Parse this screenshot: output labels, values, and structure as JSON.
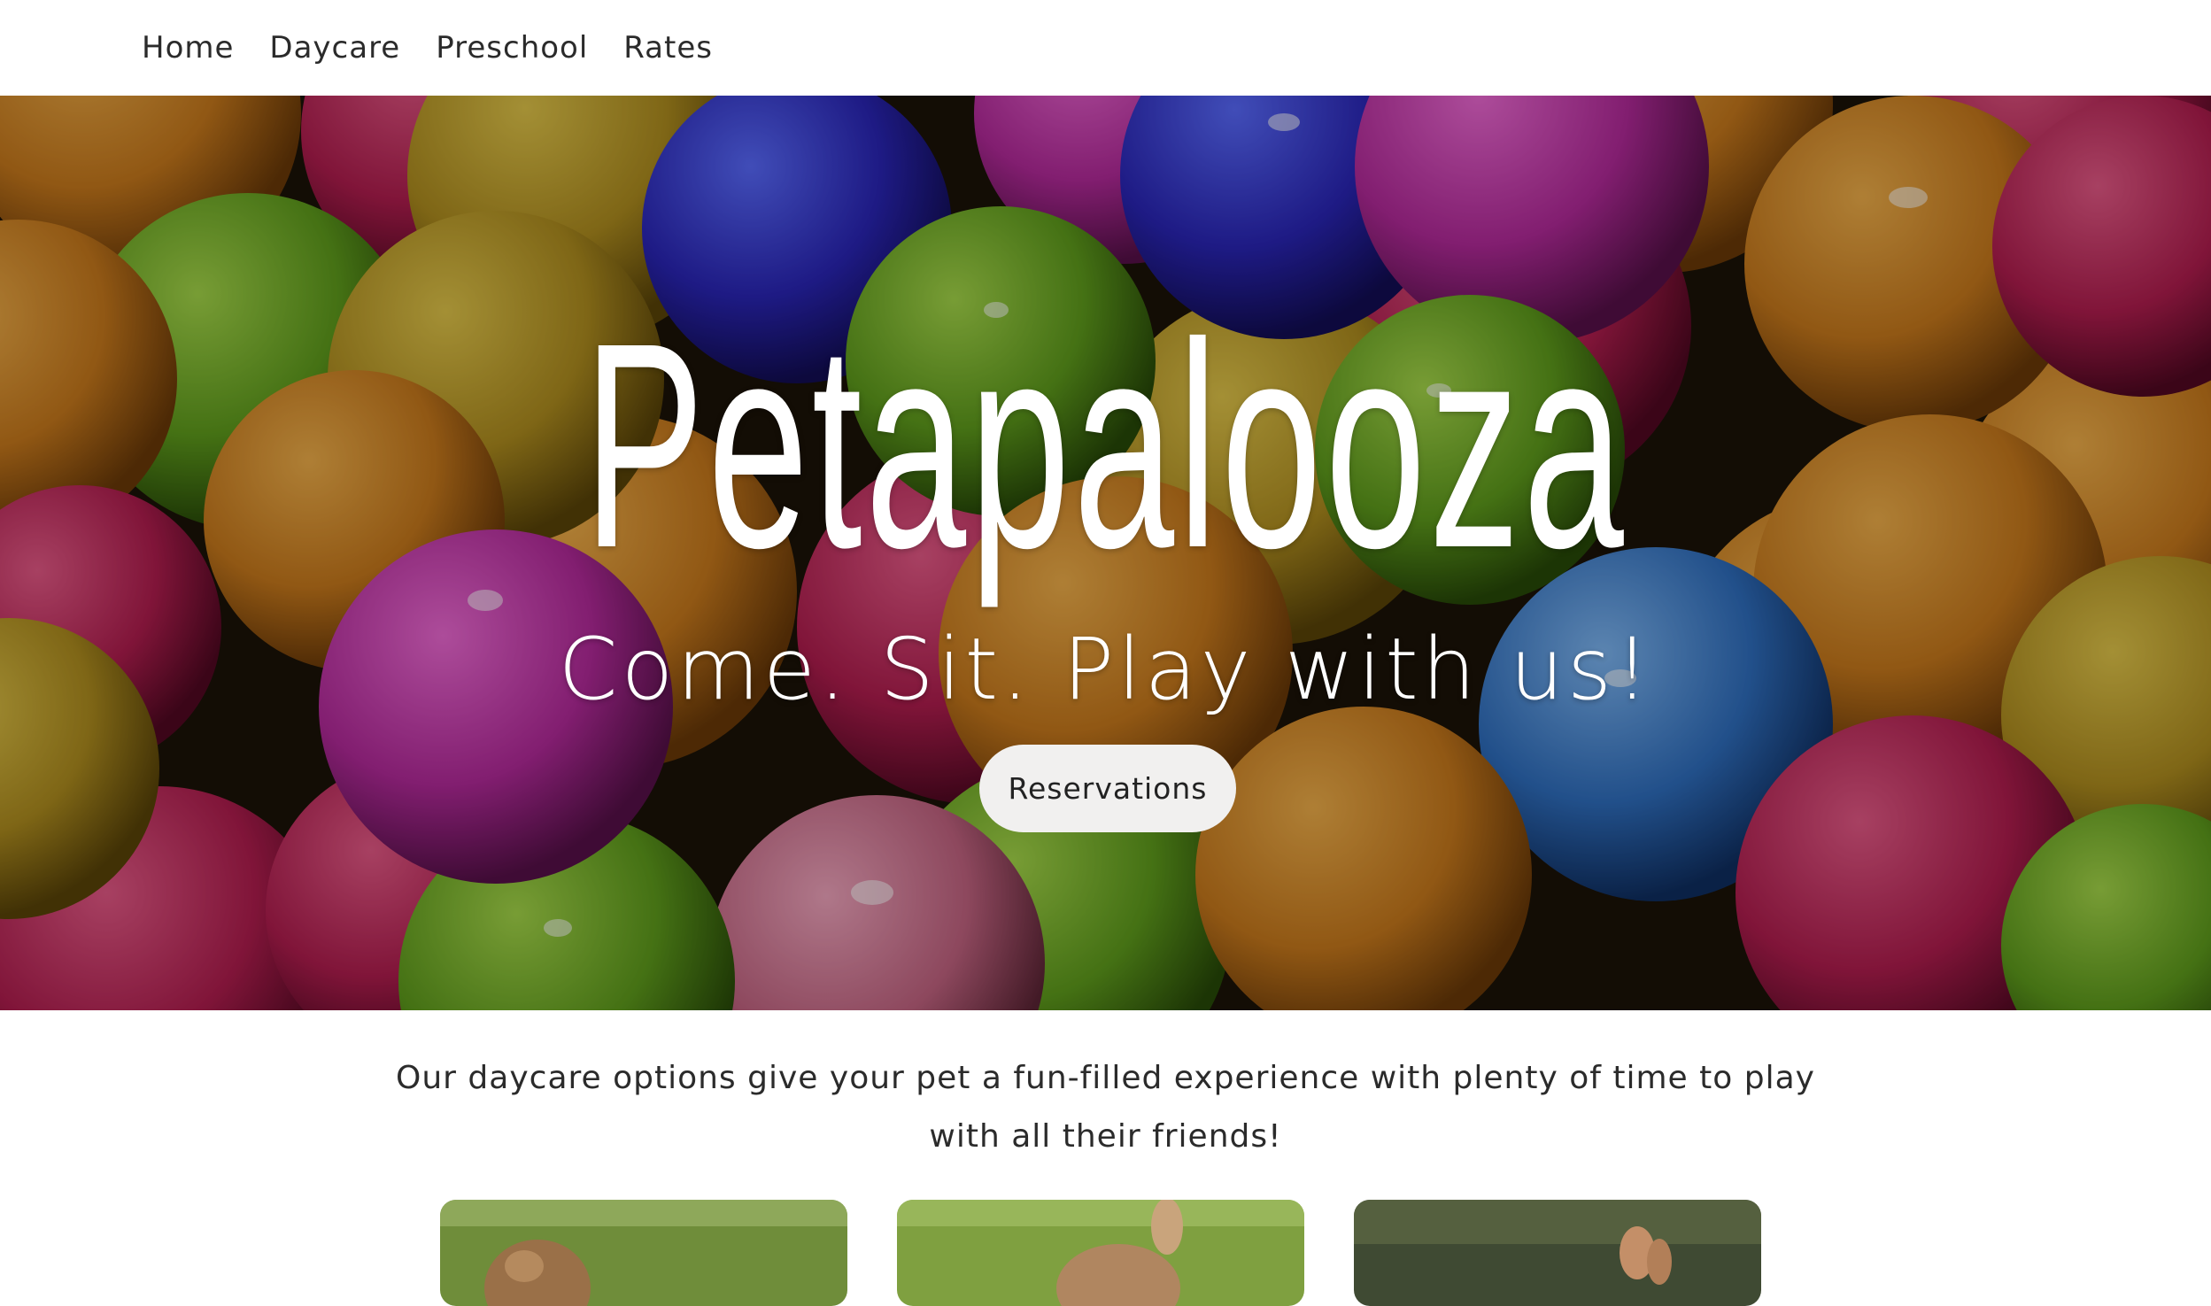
{
  "nav": {
    "items": [
      {
        "label": "Home"
      },
      {
        "label": "Daycare"
      },
      {
        "label": "Preschool"
      },
      {
        "label": "Rates"
      }
    ]
  },
  "hero": {
    "title": "Petapalooza",
    "tagline": "Come. Sit. Play with us!",
    "button_label": "Reservations",
    "background_description_icon": "ball-pit-image"
  },
  "intro": {
    "line1": "Our daycare options give your pet a fun-filled experience with plenty of time to play",
    "line2": "with all their friends!"
  },
  "cards": [
    {
      "image": "dog-on-grass-photo-1"
    },
    {
      "image": "dog-on-grass-photo-2"
    },
    {
      "image": "dog-on-grass-photo-3"
    }
  ],
  "colors": {
    "nav_text": "#2b2b2b",
    "button_bg": "#f1f0ef",
    "body_bg": "#ffffff"
  }
}
